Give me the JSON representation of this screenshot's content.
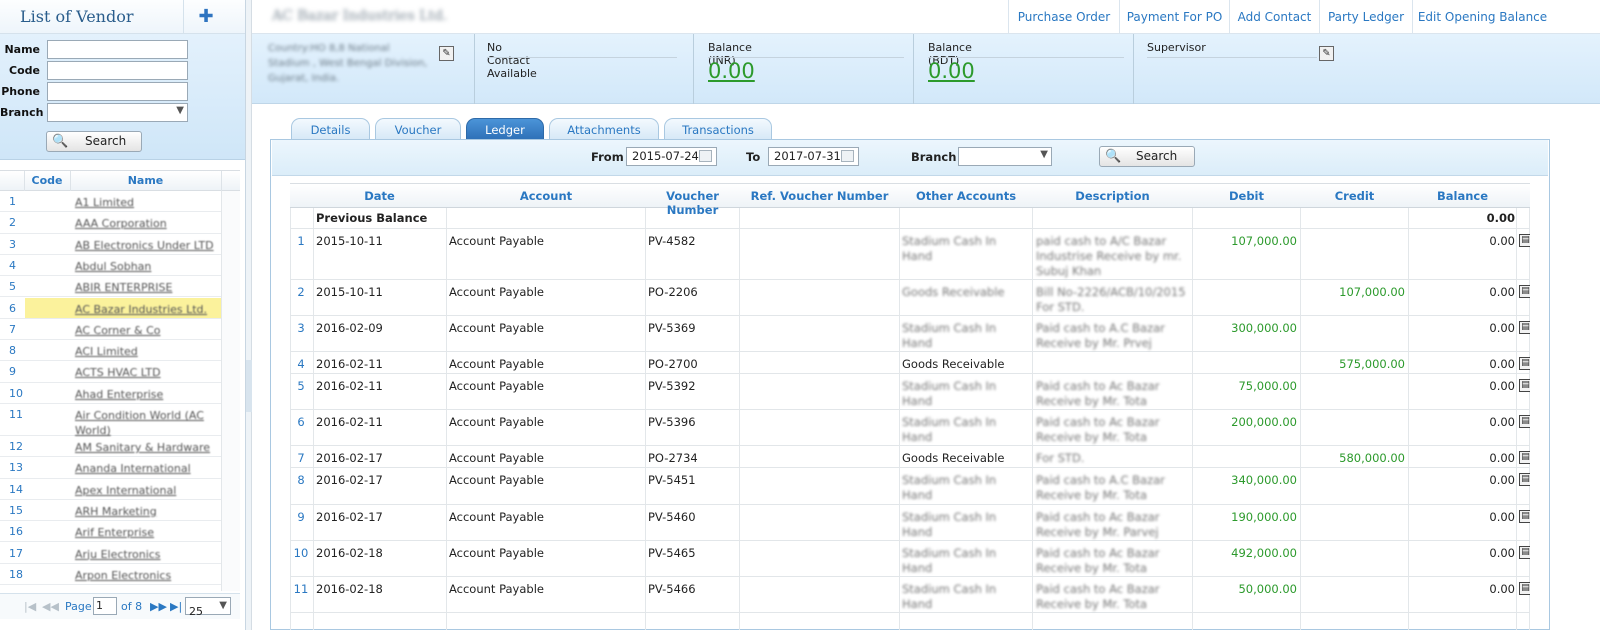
{
  "left": {
    "title": "List of Vendor",
    "add_icon": "plus-icon",
    "filters": {
      "name_label": "Name",
      "code_label": "Code",
      "phone_label": "Phone",
      "branch_label": "Branch",
      "name_value": "",
      "code_value": "",
      "phone_value": "",
      "branch_value": ""
    },
    "search_label": "Search",
    "grid": {
      "headers": [
        "Code",
        "Name"
      ],
      "rows": [
        {
          "num": "1",
          "name": "A1 Limited"
        },
        {
          "num": "2",
          "name": "AAA Corporation"
        },
        {
          "num": "3",
          "name": "AB Electronics Under LTD"
        },
        {
          "num": "4",
          "name": "Abdul Sobhan"
        },
        {
          "num": "5",
          "name": "ABIR ENTERPRISE"
        },
        {
          "num": "6",
          "name": "AC Bazar Industries Ltd."
        },
        {
          "num": "7",
          "name": "AC Corner & Co"
        },
        {
          "num": "8",
          "name": "ACI Limited"
        },
        {
          "num": "9",
          "name": "ACTS HVAC LTD"
        },
        {
          "num": "10",
          "name": "Ahad Enterprise"
        },
        {
          "num": "11",
          "name": "Air Condition World (AC World)"
        },
        {
          "num": "12",
          "name": "AM Sanitary & Hardware"
        },
        {
          "num": "13",
          "name": "Ananda International"
        },
        {
          "num": "14",
          "name": "Apex International"
        },
        {
          "num": "15",
          "name": "ARH Marketing"
        },
        {
          "num": "16",
          "name": "Arif Enterprise"
        },
        {
          "num": "17",
          "name": "Arju Electronics"
        },
        {
          "num": "18",
          "name": "Arpon Electronics"
        }
      ],
      "selected_index": 6
    },
    "pager": {
      "first": "|◀",
      "prev": "◀◀",
      "page_label": "Page",
      "page_value": "1",
      "of_label": "of 8",
      "next": "▶▶",
      "last": "▶|",
      "page_size": "25"
    }
  },
  "top": {
    "vendor_title": "AC Bazar Industries Ltd.",
    "links": [
      "Purchase Order",
      "Payment For PO",
      "Add Contact",
      "Party Ledger",
      "Edit Opening Balance"
    ]
  },
  "info": {
    "address": "Country:HO 8,8 National Stadium , West Bengal Division, Gujarat, India.",
    "contact": "No Contact Available",
    "balance_inr_label": "Balance (INR)",
    "balance_inr_value": "0.00",
    "balance_bdt_label": "Balance (BDT)",
    "balance_bdt_value": "0.00",
    "supervisor_label": "Supervisor"
  },
  "tabs": [
    "Details",
    "Voucher",
    "Ledger",
    "Attachments",
    "Transactions"
  ],
  "active_tab": "Ledger",
  "ledger_filter": {
    "from_label": "From",
    "from_value": "2015-07-24",
    "to_label": "To",
    "to_value": "2017-07-31",
    "branch_label": "Branch",
    "branch_value": "",
    "search_label": "Search"
  },
  "ledger": {
    "headers": [
      "Date",
      "Account",
      "Voucher Number",
      "Ref. Voucher Number",
      "Other Accounts",
      "Description",
      "Debit",
      "Credit",
      "Balance"
    ],
    "previous_balance_label": "Previous Balance",
    "previous_balance_value": "0.00",
    "rows": [
      {
        "num": "1",
        "date": "2015-10-11",
        "account": "Account Payable",
        "voucher": "PV-4582",
        "ref": "",
        "other": "Stadium Cash In Hand",
        "other_blur": true,
        "desc": "paid cash to A/C Bazar Industrise Receive by mr. Subuj Khan",
        "debit": "107,000.00",
        "credit": "",
        "balance": "0.00"
      },
      {
        "num": "2",
        "date": "2015-10-11",
        "account": "Account Payable",
        "voucher": "PO-2206",
        "ref": "",
        "other": "Goods Receivable",
        "other_blur": true,
        "desc": "Bill No-2226/ACB/10/2015 For STD.",
        "debit": "",
        "credit": "107,000.00",
        "balance": "0.00"
      },
      {
        "num": "3",
        "date": "2016-02-09",
        "account": "Account Payable",
        "voucher": "PV-5369",
        "ref": "",
        "other": "Stadium Cash In Hand",
        "other_blur": true,
        "desc": "Paid cash to A.C Bazar Receive by Mr. Prvej",
        "debit": "300,000.00",
        "credit": "",
        "balance": "0.00"
      },
      {
        "num": "4",
        "date": "2016-02-11",
        "account": "Account Payable",
        "voucher": "PO-2700",
        "ref": "",
        "other": "Goods Receivable",
        "other_blur": false,
        "desc": "",
        "debit": "",
        "credit": "575,000.00",
        "balance": "0.00"
      },
      {
        "num": "5",
        "date": "2016-02-11",
        "account": "Account Payable",
        "voucher": "PV-5392",
        "ref": "",
        "other": "Stadium Cash In Hand",
        "other_blur": true,
        "desc": "Paid cash to Ac Bazar Receive by Mr. Tota",
        "debit": "75,000.00",
        "credit": "",
        "balance": "0.00"
      },
      {
        "num": "6",
        "date": "2016-02-11",
        "account": "Account Payable",
        "voucher": "PV-5396",
        "ref": "",
        "other": "Stadium Cash In Hand",
        "other_blur": true,
        "desc": "Paid cash to Ac Bazar Receive by Mr. Tota",
        "debit": "200,000.00",
        "credit": "",
        "balance": "0.00"
      },
      {
        "num": "7",
        "date": "2016-02-17",
        "account": "Account Payable",
        "voucher": "PO-2734",
        "ref": "",
        "other": "Goods Receivable",
        "other_blur": false,
        "desc": "For STD.",
        "debit": "",
        "credit": "580,000.00",
        "balance": "0.00"
      },
      {
        "num": "8",
        "date": "2016-02-17",
        "account": "Account Payable",
        "voucher": "PV-5451",
        "ref": "",
        "other": "Stadium Cash In Hand",
        "other_blur": true,
        "desc": "Paid cash to A.C Bazar Receive by Mr. Tota",
        "debit": "340,000.00",
        "credit": "",
        "balance": "0.00"
      },
      {
        "num": "9",
        "date": "2016-02-17",
        "account": "Account Payable",
        "voucher": "PV-5460",
        "ref": "",
        "other": "Stadium Cash In Hand",
        "other_blur": true,
        "desc": "Paid cash to Ac Bazar Receive by Mr. Parvej",
        "debit": "190,000.00",
        "credit": "",
        "balance": "0.00"
      },
      {
        "num": "10",
        "date": "2016-02-18",
        "account": "Account Payable",
        "voucher": "PV-5465",
        "ref": "",
        "other": "Stadium Cash In Hand",
        "other_blur": true,
        "desc": "Paid cash to Ac Bazar Receive by Mr. Tota",
        "debit": "492,000.00",
        "credit": "",
        "balance": "0.00"
      },
      {
        "num": "11",
        "date": "2016-02-18",
        "account": "Account Payable",
        "voucher": "PV-5466",
        "ref": "",
        "other": "Stadium Cash In Hand",
        "other_blur": true,
        "desc": "Paid cash to Ac Bazar Receive by Mr. Tota",
        "debit": "50,000.00",
        "credit": "",
        "balance": "0.00"
      }
    ],
    "row_icon": "print-icon"
  },
  "colors": {
    "accent_blue": "#2a78c2",
    "amount_green": "#2c9a2c",
    "selected_row": "#fbf29c",
    "active_tab": "#2f71b8"
  }
}
